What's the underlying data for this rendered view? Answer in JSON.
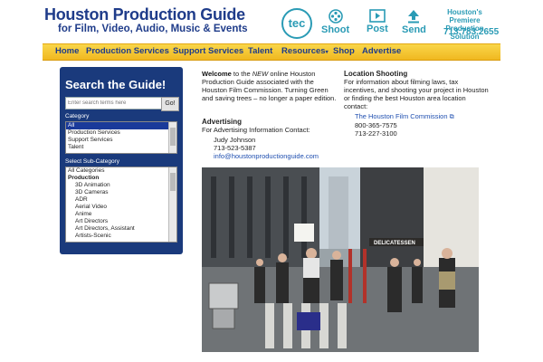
{
  "header": {
    "title": "Houston Production Guide",
    "subtitle": "for Film, Video, Audio, Music & Events",
    "tec": "tec",
    "icons": [
      {
        "name": "film-reel-icon",
        "label": "Shoot"
      },
      {
        "name": "play-icon",
        "label": "Post"
      },
      {
        "name": "upload-icon",
        "label": "Send"
      }
    ],
    "tagline_1": "Houston's Premiere",
    "tagline_2": "Production Solution",
    "phone": "713.783.2655"
  },
  "nav": {
    "items": [
      "Home",
      "Production Services",
      "Support Services",
      "Talent",
      "Resources",
      "Shop",
      "Advertise"
    ]
  },
  "sidebar": {
    "title": "Search the Guide!",
    "search_placeholder": "Enter search terms here",
    "go_label": "Go!",
    "category_label": "Category",
    "categories": [
      "All",
      "Production Services",
      "Support Services",
      "Talent"
    ],
    "subcategory_label": "Select Sub-Category",
    "subcategories": [
      "All Categories",
      "Production",
      "3D Animation",
      "3D Cameras",
      "ADR",
      "Aerial Video",
      "Anime",
      "Art Directors",
      "Art Directors, Assistant",
      "Artists-Scenic"
    ]
  },
  "welcome": {
    "bold": "Welcome",
    "text_1": "to the",
    "new_word": "NEW",
    "text_2": "online Houston Production Guide associated with the Houston Film Commission.  Turning Green and saving trees – no longer a paper edition."
  },
  "advertising": {
    "title": "Advertising",
    "subtitle": "For Advertising Information Contact:",
    "name": "Judy Johnson",
    "phone": "713-523-5387",
    "email": "info@houstonproductionguide.com"
  },
  "location": {
    "title": "Location Shooting",
    "text": "For information about filming laws, tax incentives, and shooting your project in Houston or finding the best Houston area location contact:",
    "link": "The Houston Film Commission",
    "phone_1": "800-365-7575",
    "phone_2": "713-227-3100"
  },
  "photo": {
    "sign_text": "DELICATESSEN"
  },
  "colors": {
    "brand_blue": "#1f3c8a",
    "accent_teal": "#2a9bb5",
    "nav_yellow": "#f4c430",
    "sidebar_navy": "#1a3a7c"
  }
}
